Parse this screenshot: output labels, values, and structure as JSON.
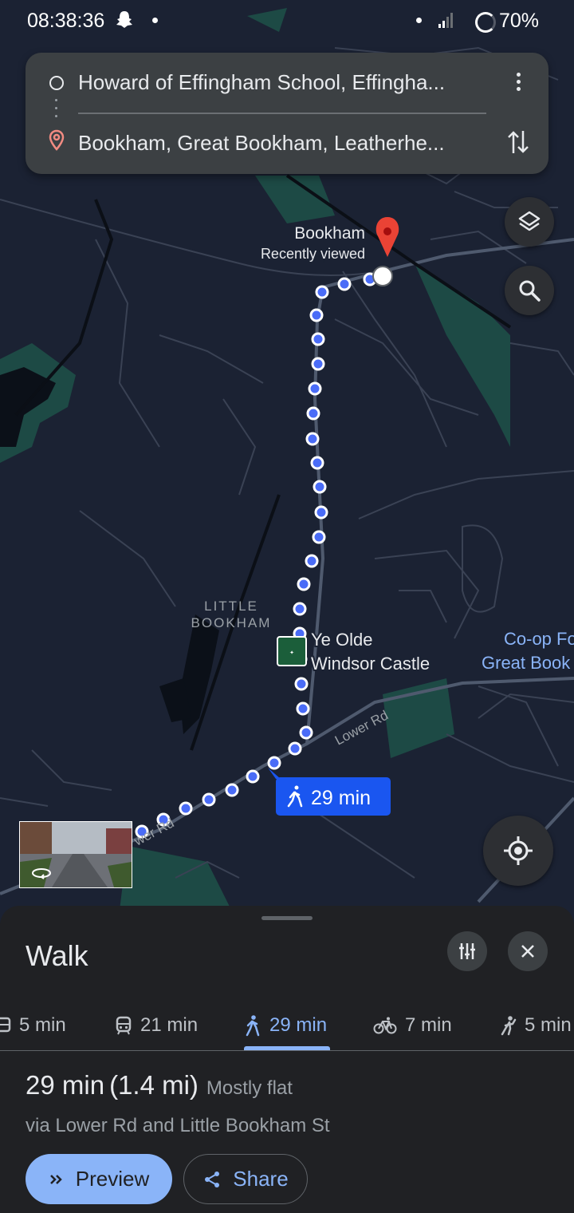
{
  "status_bar": {
    "time": "08:38:36",
    "battery": "70%"
  },
  "directions": {
    "origin": "Howard of Effingham School, Effingha...",
    "destination": "Bookham, Great Bookham, Leatherhe..."
  },
  "map": {
    "place_name": "Bookham",
    "place_subtitle": "Recently viewed",
    "area_label_line1": "LITTLE",
    "area_label_line2": "BOOKHAM",
    "poi_line1": "Ye Olde",
    "poi_line2": "Windsor Castle",
    "poi_right_line1": "Co-op Fo",
    "poi_right_line2": "Great Book",
    "road_label_1": "Lower Rd",
    "road_label_2": "wer Rd",
    "route_badge": "29 min",
    "colors": {
      "background": "#1b2233",
      "route": "#4a6cf7",
      "pin": "#ea4335",
      "park": "#1d4a45"
    }
  },
  "sheet": {
    "title": "Walk",
    "modes": [
      {
        "icon": "bus-icon",
        "label": "5 min"
      },
      {
        "icon": "train-icon",
        "label": "21 min"
      },
      {
        "icon": "walk-icon",
        "label": "29 min",
        "active": true
      },
      {
        "icon": "bike-icon",
        "label": "7 min"
      },
      {
        "icon": "ride-icon",
        "label": "5 min"
      }
    ],
    "summary_duration": "29 min",
    "summary_distance": "(1.4 mi)",
    "summary_note": "Mostly flat",
    "via": "via Lower Rd and Little Bookham St",
    "preview_label": "Preview",
    "share_label": "Share",
    "colors": {
      "accent": "#8ab4f8",
      "sheet_bg": "#202124"
    }
  }
}
